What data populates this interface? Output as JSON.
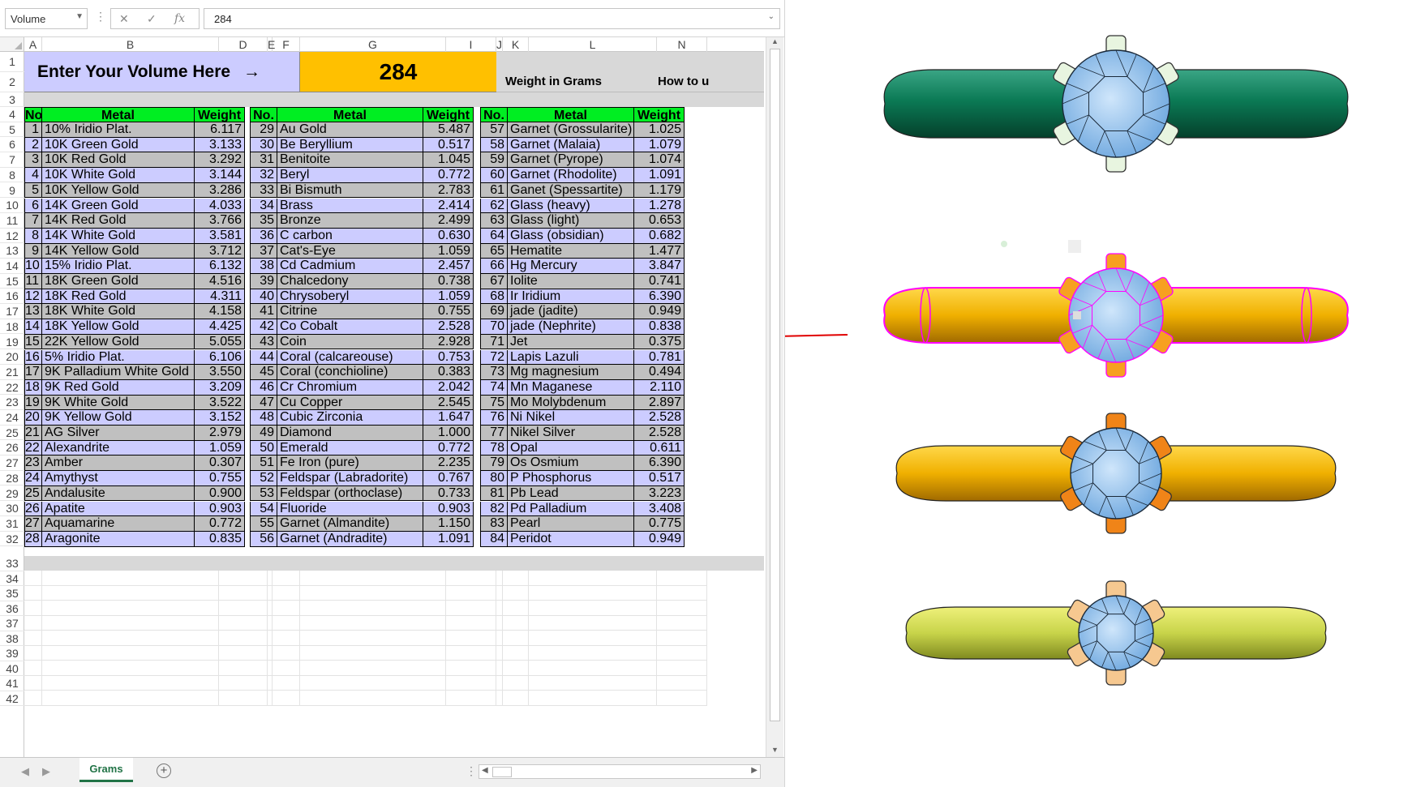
{
  "formula_bar": {
    "name_box": "Volume",
    "cancel_icon": "✕",
    "enter_icon": "✓",
    "fx_label": "fx",
    "formula_value": "284"
  },
  "columns": [
    "A",
    "B",
    "D",
    "E",
    "F",
    "G",
    "I",
    "J",
    "K",
    "L",
    "N"
  ],
  "rows": [
    "1",
    "2",
    "3",
    "4",
    "5",
    "6",
    "7",
    "8",
    "9",
    "10",
    "11",
    "12",
    "13",
    "14",
    "15",
    "16",
    "17",
    "18",
    "19",
    "20",
    "21",
    "22",
    "23",
    "24",
    "25",
    "26",
    "27",
    "28",
    "29",
    "30",
    "31",
    "32",
    "33",
    "34",
    "35",
    "36",
    "37",
    "38",
    "39",
    "40",
    "41",
    "42"
  ],
  "banner": {
    "prompt": "Enter Your Volume Here",
    "arrow": "→",
    "volume": "284",
    "weight_label": "Weight in Grams",
    "howto_label": "How to u"
  },
  "table_headers": [
    {
      "no": "No",
      "metal": "Metal",
      "weight": "Weight"
    },
    {
      "no": "No.",
      "metal": "Metal",
      "weight": "Weight"
    },
    {
      "no": "No.",
      "metal": "Metal",
      "weight": "Weight"
    }
  ],
  "tables": [
    [
      [
        "1",
        "10% Iridio Plat.",
        "6.117"
      ],
      [
        "2",
        "10K Green Gold",
        "3.133"
      ],
      [
        "3",
        "10K Red Gold",
        "3.292"
      ],
      [
        "4",
        "10K White Gold",
        "3.144"
      ],
      [
        "5",
        "10K Yellow Gold",
        "3.286"
      ],
      [
        "6",
        "14K Green Gold",
        "4.033"
      ],
      [
        "7",
        "14K Red Gold",
        "3.766"
      ],
      [
        "8",
        "14K White Gold",
        "3.581"
      ],
      [
        "9",
        "14K Yellow Gold",
        "3.712"
      ],
      [
        "10",
        "15% Iridio Plat.",
        "6.132"
      ],
      [
        "11",
        "18K Green Gold",
        "4.516"
      ],
      [
        "12",
        "18K Red Gold",
        "4.311"
      ],
      [
        "13",
        "18K White Gold",
        "4.158"
      ],
      [
        "14",
        "18K Yellow Gold",
        "4.425"
      ],
      [
        "15",
        "22K Yellow Gold",
        "5.055"
      ],
      [
        "16",
        "5% Iridio Plat.",
        "6.106"
      ],
      [
        "17",
        "9K Palladium White Gold",
        "3.550"
      ],
      [
        "18",
        "9K Red Gold",
        "3.209"
      ],
      [
        "19",
        "9K White Gold",
        "3.522"
      ],
      [
        "20",
        "9K Yellow Gold",
        "3.152"
      ],
      [
        "21",
        "AG Silver",
        "2.979"
      ],
      [
        "22",
        "Alexandrite",
        "1.059"
      ],
      [
        "23",
        "Amber",
        "0.307"
      ],
      [
        "24",
        "Amythyst",
        "0.755"
      ],
      [
        "25",
        "Andalusite",
        "0.900"
      ],
      [
        "26",
        "Apatite",
        "0.903"
      ],
      [
        "27",
        "Aquamarine",
        "0.772"
      ],
      [
        "28",
        "Aragonite",
        "0.835"
      ]
    ],
    [
      [
        "29",
        "Au Gold",
        "5.487"
      ],
      [
        "30",
        "Be Beryllium",
        "0.517"
      ],
      [
        "31",
        "Benitoite",
        "1.045"
      ],
      [
        "32",
        "Beryl",
        "0.772"
      ],
      [
        "33",
        "Bi Bismuth",
        "2.783"
      ],
      [
        "34",
        "Brass",
        "2.414"
      ],
      [
        "35",
        "Bronze",
        "2.499"
      ],
      [
        "36",
        "C carbon",
        "0.630"
      ],
      [
        "37",
        "Cat's-Eye",
        "1.059"
      ],
      [
        "38",
        "Cd Cadmium",
        "2.457"
      ],
      [
        "39",
        "Chalcedony",
        "0.738"
      ],
      [
        "40",
        "Chrysoberyl",
        "1.059"
      ],
      [
        "41",
        "Citrine",
        "0.755"
      ],
      [
        "42",
        "Co Cobalt",
        "2.528"
      ],
      [
        "43",
        "Coin",
        "2.928"
      ],
      [
        "44",
        "Coral (calcareouse)",
        "0.753"
      ],
      [
        "45",
        "Coral (conchioline)",
        "0.383"
      ],
      [
        "46",
        "Cr Chromium",
        "2.042"
      ],
      [
        "47",
        "Cu Copper",
        "2.545"
      ],
      [
        "48",
        "Cubic Zirconia",
        "1.647"
      ],
      [
        "49",
        "Diamond",
        "1.000"
      ],
      [
        "50",
        "Emerald",
        "0.772"
      ],
      [
        "51",
        "Fe Iron (pure)",
        "2.235"
      ],
      [
        "52",
        "Feldspar (Labradorite)",
        "0.767"
      ],
      [
        "53",
        "Feldspar (orthoclase)",
        "0.733"
      ],
      [
        "54",
        "Fluoride",
        "0.903"
      ],
      [
        "55",
        "Garnet (Almandite)",
        "1.150"
      ],
      [
        "56",
        "Garnet (Andradite)",
        "1.091"
      ]
    ],
    [
      [
        "57",
        "Garnet (Grossularite)",
        "1.025"
      ],
      [
        "58",
        "Garnet (Malaia)",
        "1.079"
      ],
      [
        "59",
        "Garnet (Pyrope)",
        "1.074"
      ],
      [
        "60",
        "Garnet (Rhodolite)",
        "1.091"
      ],
      [
        "61",
        "Ganet (Spessartite)",
        "1.179"
      ],
      [
        "62",
        "Glass (heavy)",
        "1.278"
      ],
      [
        "63",
        "Glass (light)",
        "0.653"
      ],
      [
        "64",
        "Glass (obsidian)",
        "0.682"
      ],
      [
        "65",
        "Hematite",
        "1.477"
      ],
      [
        "66",
        "Hg Mercury",
        "3.847"
      ],
      [
        "67",
        "Iolite",
        "0.741"
      ],
      [
        "68",
        "Ir Iridium",
        "6.390"
      ],
      [
        "69",
        "jade (jadite)",
        "0.949"
      ],
      [
        "70",
        "jade (Nephrite)",
        "0.838"
      ],
      [
        "71",
        "Jet",
        "0.375"
      ],
      [
        "72",
        "Lapis Lazuli",
        "0.781"
      ],
      [
        "73",
        "Mg magnesium",
        "0.494"
      ],
      [
        "74",
        "Mn Maganese",
        "2.110"
      ],
      [
        "75",
        "Mo Molybdenum",
        "2.897"
      ],
      [
        "76",
        "Ni Nikel",
        "2.528"
      ],
      [
        "77",
        "Nikel Silver",
        "2.528"
      ],
      [
        "78",
        "Opal",
        "0.611"
      ],
      [
        "79",
        "Os Osmium",
        "6.390"
      ],
      [
        "80",
        "P Phosphorus",
        "0.517"
      ],
      [
        "81",
        "Pb Lead",
        "3.223"
      ],
      [
        "82",
        "Pd Palladium",
        "3.408"
      ],
      [
        "83",
        "Pearl",
        "0.775"
      ],
      [
        "84",
        "Peridot",
        "0.949"
      ]
    ]
  ],
  "sheet_tabs": {
    "active": "Grams",
    "add_icon": "+"
  },
  "colors": {
    "banner_bg": "#ccccff",
    "volume_bg": "#ffc000",
    "header_green": "#00ee22",
    "row_grey": "#c0c0c0",
    "row_lavender": "#ccccff",
    "ring_green": "#0b7a55",
    "ring_gold": "#f0b000",
    "ring_yellowgreen": "#c8d44a",
    "selection_magenta": "#ff00ff",
    "arrow_red": "#e00000",
    "stone_blue": "#8fc3ef"
  },
  "icons": [
    "cancel-icon",
    "enter-icon",
    "fx-icon",
    "dropdown-icon",
    "select-all-icon",
    "scroll-up-icon",
    "scroll-down-icon",
    "scroll-left-icon",
    "scroll-right-icon",
    "add-sheet-icon",
    "red-arrow-icon"
  ]
}
